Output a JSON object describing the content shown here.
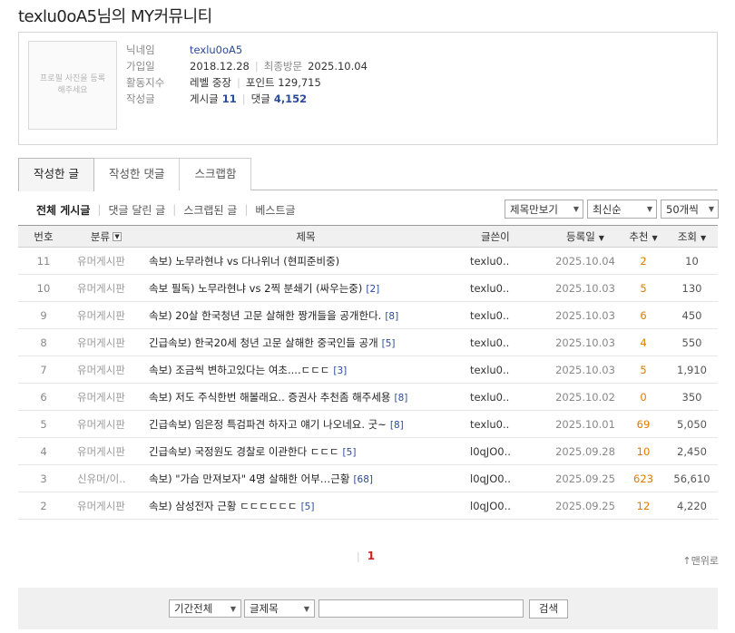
{
  "page_title": "texlu0oA5님의 MY커뮤니티",
  "profile": {
    "photo_placeholder": "프로필 사진을 등록해주세요",
    "nickname_label": "닉네임",
    "nickname": "texlu0oA5",
    "joined_label": "가입일",
    "joined": "2018.12.28",
    "last_visit_label": "최종방문",
    "last_visit": "2025.10.04",
    "activity_label": "활동지수",
    "level": "레벨 중장",
    "points": "포인트 129,715",
    "posts_label": "작성글",
    "post_count_label": "게시글",
    "post_count": "11",
    "comment_count_label": "댓글",
    "comment_count": "4,152"
  },
  "tabs": [
    {
      "label": "작성한 글"
    },
    {
      "label": "작성한 댓글"
    },
    {
      "label": "스크랩함"
    }
  ],
  "filters": [
    {
      "label": "전체 게시글"
    },
    {
      "label": "댓글 달린 글"
    },
    {
      "label": "스크랩된 글"
    },
    {
      "label": "베스트글"
    }
  ],
  "selects": {
    "view_mode": "제목만보기",
    "sort": "최신순",
    "per_page": "50개씩"
  },
  "columns": {
    "num": "번호",
    "category": "분류",
    "title": "제목",
    "author": "글쓴이",
    "date": "등록일",
    "recommend": "추천",
    "views": "조회"
  },
  "rows": [
    {
      "num": "11",
      "category": "유머게시판",
      "title": "속보) 노무라현냐 vs 다나위너 (현피준비중)",
      "comments": "",
      "author": "texlu0..",
      "date": "2025.10.04",
      "recommend": "2",
      "views": "10"
    },
    {
      "num": "10",
      "category": "유머게시판",
      "title": "속보 필독) 노무라현냐 vs 2찍 분쇄기 (싸우는중)",
      "comments": "[2]",
      "author": "texlu0..",
      "date": "2025.10.03",
      "recommend": "5",
      "views": "130"
    },
    {
      "num": "9",
      "category": "유머게시판",
      "title": "속보) 20살 한국청년 고문 살해한 짱개들을 공개한다.",
      "comments": "[8]",
      "author": "texlu0..",
      "date": "2025.10.03",
      "recommend": "6",
      "views": "450"
    },
    {
      "num": "8",
      "category": "유머게시판",
      "title": "긴급속보) 한국20세 청년 고문 살해한 중국인들 공개",
      "comments": "[5]",
      "author": "texlu0..",
      "date": "2025.10.03",
      "recommend": "4",
      "views": "550"
    },
    {
      "num": "7",
      "category": "유머게시판",
      "title": "속보) 조금씩 변하고있다는 여초....ㄷㄷㄷ",
      "comments": "[3]",
      "author": "texlu0..",
      "date": "2025.10.03",
      "recommend": "5",
      "views": "1,910"
    },
    {
      "num": "6",
      "category": "유머게시판",
      "title": "속보) 저도 주식한번 해볼래요.. 증권사 추천좀 해주세용",
      "comments": "[8]",
      "author": "texlu0..",
      "date": "2025.10.02",
      "recommend": "0",
      "views": "350"
    },
    {
      "num": "5",
      "category": "유머게시판",
      "title": "긴급속보) 임은정 특검파견 하자고 얘기 나오네요. 굿~",
      "comments": "[8]",
      "author": "texlu0..",
      "date": "2025.10.01",
      "recommend": "69",
      "views": "5,050"
    },
    {
      "num": "4",
      "category": "유머게시판",
      "title": "긴급속보) 국정원도 경찰로 이관한다 ㄷㄷㄷ",
      "comments": "[5]",
      "author": "l0qJO0..",
      "date": "2025.09.28",
      "recommend": "10",
      "views": "2,450"
    },
    {
      "num": "3",
      "category": "신유머/이..",
      "title": "속보) \"가슴 만져보자\" 4명 살해한 어부…근황",
      "comments": "[68]",
      "author": "l0qJO0..",
      "date": "2025.09.25",
      "recommend": "623",
      "views": "56,610"
    },
    {
      "num": "2",
      "category": "유머게시판",
      "title": "속보) 삼성전자 근황 ㄷㄷㄷㄷㄷㄷ",
      "comments": "[5]",
      "author": "l0qJO0..",
      "date": "2025.09.25",
      "recommend": "12",
      "views": "4,220"
    }
  ],
  "pagination": {
    "current": "1"
  },
  "to_top": "↑맨위로",
  "search": {
    "period": "기간전체",
    "field": "글제목",
    "button": "검색"
  }
}
